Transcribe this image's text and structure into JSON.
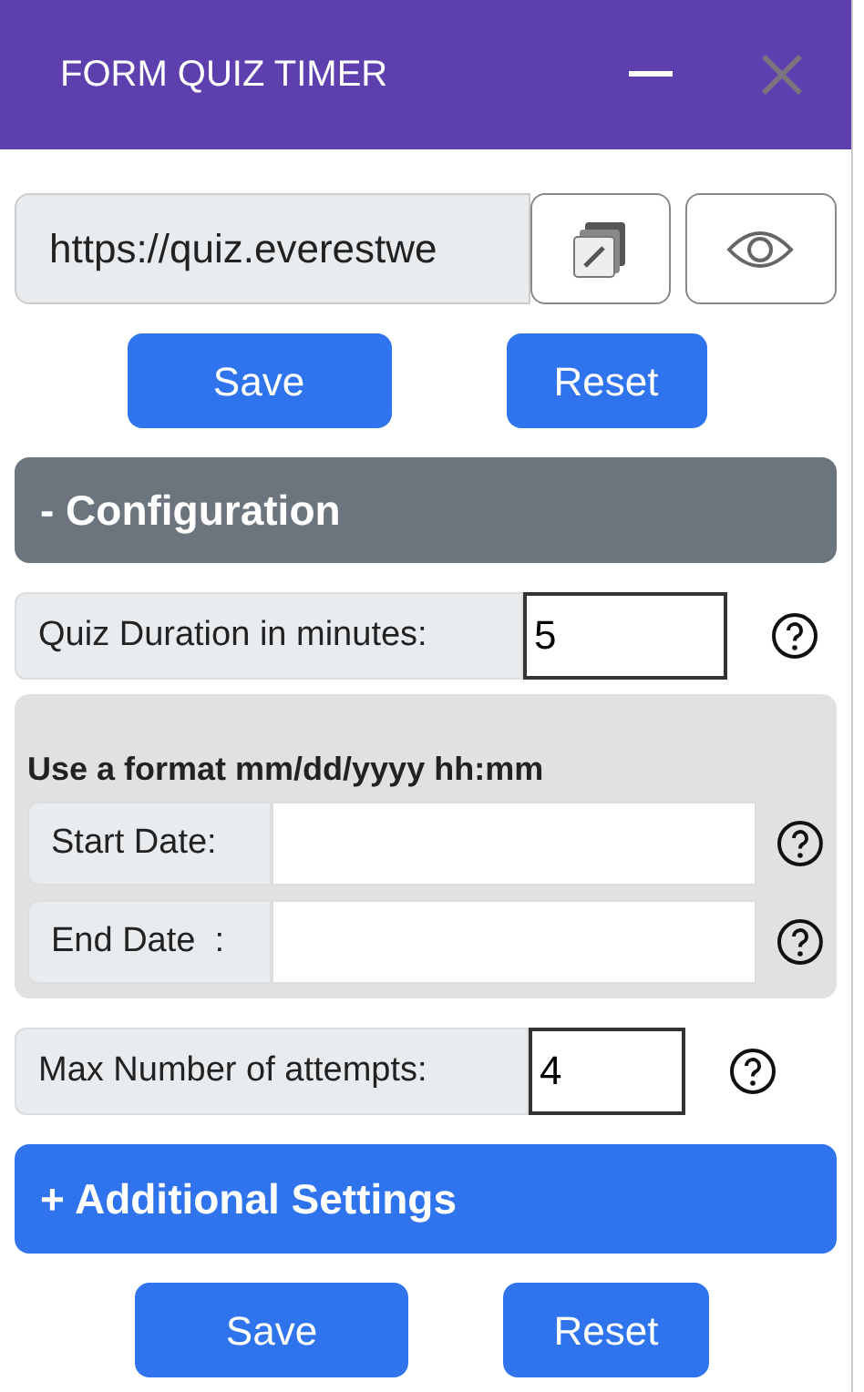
{
  "window": {
    "title": "FORM QUIZ TIMER"
  },
  "url_field": {
    "value": "https://quiz.everestwe"
  },
  "top_buttons": [
    "Save",
    "Reset"
  ],
  "configuration": {
    "heading": "- Configuration",
    "duration": {
      "label": "Quiz Duration in minutes:",
      "value": "5"
    },
    "date_group": {
      "hint": "Use a format mm/dd/yyyy hh:mm",
      "fields": [
        {
          "label": "Start Date:"
        },
        {
          "label": "End Date  :"
        }
      ]
    },
    "attempts": {
      "label": "Max Number of attempts:",
      "value": "4"
    }
  },
  "additional_settings": {
    "heading": "+ Additional Settings"
  },
  "bottom_buttons": [
    "Save",
    "Reset"
  ]
}
